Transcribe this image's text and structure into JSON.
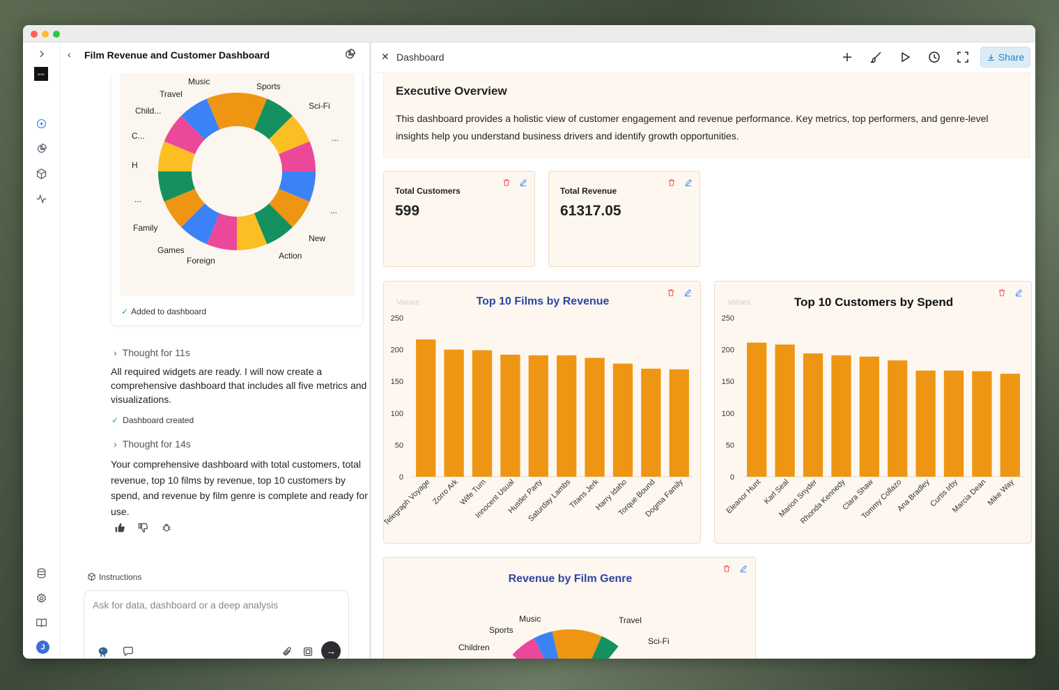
{
  "chat": {
    "title": "Film Revenue and Customer Dashboard",
    "added_status": "Added to dashboard",
    "thought1": "Thought for 11s",
    "message1": "All required widgets are ready. I will now create a comprehensive dashboard that includes all five metrics and visualizations.",
    "status_created": "Dashboard created",
    "thought2": "Thought for 14s",
    "message2": "Your comprehensive dashboard with total customers, total revenue, top 10 films by revenue, top 10 customers by spend, and revenue by film genre is complete and ready for use.",
    "instructions_label": "Instructions",
    "input_placeholder": "Ask for data, dashboard or a deep analysis",
    "donut_labels": [
      "Music",
      "Sports",
      "Travel",
      "Sci-Fi",
      "Child...",
      "...",
      "C...",
      "H",
      "...",
      "...",
      "Family",
      "New",
      "Games",
      "Action",
      "Foreign"
    ]
  },
  "dashboard": {
    "title": "Dashboard",
    "share_label": "Share",
    "overview_title": "Executive Overview",
    "overview_text": "This dashboard provides a holistic view of customer engagement and revenue performance. Key metrics, top performers, and genre-level insights help you understand business drivers and identify growth opportunities.",
    "metrics": [
      {
        "label": "Total Customers",
        "value": "599"
      },
      {
        "label": "Total Revenue",
        "value": "61317.05"
      }
    ],
    "genre_chart_title": "Revenue by Film Genre",
    "genre_labels": [
      "Music",
      "Sports",
      "Travel",
      "Sci-Fi",
      "Children"
    ]
  },
  "chart_data": [
    {
      "type": "bar",
      "title": "Top 10 Films by Revenue",
      "legend": "Values",
      "categories": [
        "Telegraph Voyage",
        "Zorro Ark",
        "Wife Turn",
        "Innocent Usual",
        "Hustler Party",
        "Saturday Lambs",
        "Titans Jerk",
        "Harry Idaho",
        "Torque Bound",
        "Dogma Family"
      ],
      "values": [
        216,
        200,
        199,
        192,
        191,
        191,
        187,
        178,
        170,
        169
      ],
      "yticks": [
        0,
        50,
        100,
        150,
        200,
        250
      ],
      "ylim": [
        0,
        250
      ],
      "color": "#ee9613"
    },
    {
      "type": "bar",
      "title": "Top 10 Customers by Spend",
      "legend": "Values",
      "categories": [
        "Eleanor Hunt",
        "Karl Seal",
        "Marion Snyder",
        "Rhonda Kennedy",
        "Clara Shaw",
        "Tommy Collazo",
        "Ana Bradley",
        "Curtis Irby",
        "Marcia Dean",
        "Mike Way"
      ],
      "values": [
        211,
        208,
        194,
        191,
        189,
        183,
        167,
        167,
        166,
        162
      ],
      "yticks": [
        0,
        50,
        100,
        150,
        200,
        250
      ],
      "ylim": [
        0,
        250
      ],
      "color": "#ee9613"
    }
  ],
  "colors": {
    "orange": "#ee9613",
    "green": "#14915f",
    "yellow": "#fbbf24",
    "pink": "#ec4899",
    "blue": "#3b82f6",
    "accent": "#3044a1"
  }
}
